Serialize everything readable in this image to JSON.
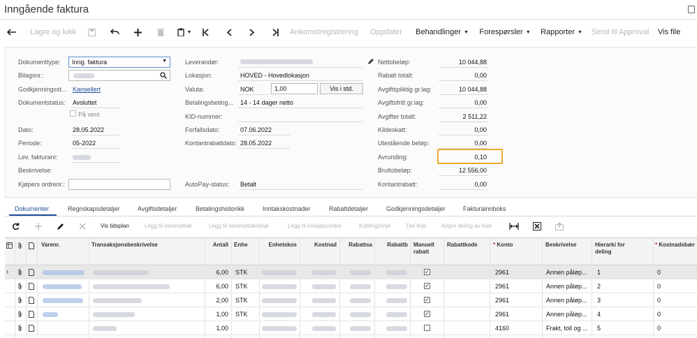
{
  "window": {
    "title": "Inngående faktura"
  },
  "toolbar": {
    "save_close": "Lagre og lukk",
    "receipt": "Ankomstregistrering",
    "updates": "Oppdater",
    "actions": "Behandlinger",
    "inquiries": "Forespørsler",
    "reports": "Rapporter",
    "send_approval": "Send til Approval",
    "show_file": "Vis file"
  },
  "form": {
    "left": {
      "doc_type_label": "Dokumenttype:",
      "doc_type_value": "Inng. faktura",
      "ref_label": "Bilagsnr.:",
      "approval_label": "Godkjenningsst...",
      "approval_value": "Kansellert",
      "status_label": "Dokumentstatus:",
      "status_value": "Avsluttet",
      "on_hold_label": "På vent",
      "date_label": "Dato:",
      "date_value": "28.05.2022",
      "period_label": "Periode:",
      "period_value": "05-2022",
      "vendor_ref_label": "Lev. fakturanr:",
      "description_label": "Beskrivelse:",
      "buyer_order_label": "Kjøpers ordrenr.:"
    },
    "middle": {
      "vendor_label": "Leverandør:",
      "location_label": "Lokasjon:",
      "location_value": "HOVED - Hovedlokasjon",
      "currency_label": "Valuta:",
      "currency_value": "NOK",
      "rate_value": "1,00",
      "view_base_label": "Vis i std.",
      "terms_label": "Betalingsbeting...",
      "terms_value": "14 - 14 dager netto",
      "kid_label": "KID-nummer:",
      "due_date_label": "Forfallsdato:",
      "due_date_value": "07.06.2022",
      "discount_date_label": "Kontantrabattdato:",
      "discount_date_value": "28.05.2022",
      "autopay_label": "AutoPay-status:",
      "autopay_value": "Betalt"
    },
    "right": {
      "net_label": "Nettobeløp:",
      "net_value": "10 044,88",
      "discount_total_label": "Rabatt totalt:",
      "discount_total_value": "0,00",
      "taxable_label": "Avgiftspliktig gr.lag:",
      "taxable_value": "10 044,88",
      "exempt_label": "Avgiftsfritt gr.lag:",
      "exempt_value": "0,00",
      "tax_total_label": "Avgifter totalt:",
      "tax_total_value": "2 511,22",
      "withholding_label": "Kildeskatt:",
      "withholding_value": "0,00",
      "balance_label": "Utestående beløp:",
      "balance_value": "0,00",
      "rounding_label": "Avrunding:",
      "rounding_value": "0,10",
      "gross_label": "Bruttobeløp:",
      "gross_value": "12 556,00",
      "cash_discount_label": "Kontantrabatt:",
      "cash_discount_value": "0,00"
    }
  },
  "tabs": [
    "Dokumenter",
    "Regnskapsdetaljer",
    "Avgiftsdetaljer",
    "Betalingshistorikk",
    "Inntakskostnader",
    "Rabattdetaljer",
    "Godkjenningsdetaljer",
    "Fakturainnboks"
  ],
  "grid_toolbar": {
    "schedule": "Vis tidsplan",
    "add_receipt": "Legg til varemottak",
    "add_receipt_line": "Legg til varemottakslinje",
    "add_po": "Legg til innkjøpsordre",
    "link_line": "Koblingslinje",
    "split_line": "Del linje",
    "view_split": "Angre deling av linje"
  },
  "grid": {
    "headers": {
      "item": "Varenr.",
      "description": "Transaksjonsbeskrivelse",
      "qty": "Antall",
      "uom": "Enhe",
      "unit_cost": "Enhetskos",
      "ext_cost": "Kostnad",
      "discount_pct": "Rabattsa",
      "discount_amt": "Rabattb",
      "manual_discount": "Manuell rabatt",
      "discount_code": "Rabattkode",
      "account": "Konto",
      "account_desc": "Beskrivelse",
      "hierarchy": "Hierarki for deling",
      "cost_center": "Kostnadsbær"
    },
    "rows": [
      {
        "qty": "6,00",
        "uom": "STK",
        "manual": true,
        "account": "2961",
        "account_desc": "Annen påløp...",
        "hierarchy": "1",
        "cost_center": "0"
      },
      {
        "qty": "6,00",
        "uom": "STK",
        "manual": true,
        "account": "2961",
        "account_desc": "Annen påløp...",
        "hierarchy": "2",
        "cost_center": "0"
      },
      {
        "qty": "2,00",
        "uom": "STK",
        "manual": true,
        "account": "2961",
        "account_desc": "Annen påløp...",
        "hierarchy": "3",
        "cost_center": "0"
      },
      {
        "qty": "1,00",
        "uom": "STK",
        "manual": true,
        "account": "2961",
        "account_desc": "Annen påløp...",
        "hierarchy": "4",
        "cost_center": "0"
      },
      {
        "qty": "1,00",
        "uom": "",
        "manual": false,
        "account": "4160",
        "account_desc": "Frakt, toll og ...",
        "hierarchy": "5",
        "cost_center": "0"
      }
    ]
  }
}
